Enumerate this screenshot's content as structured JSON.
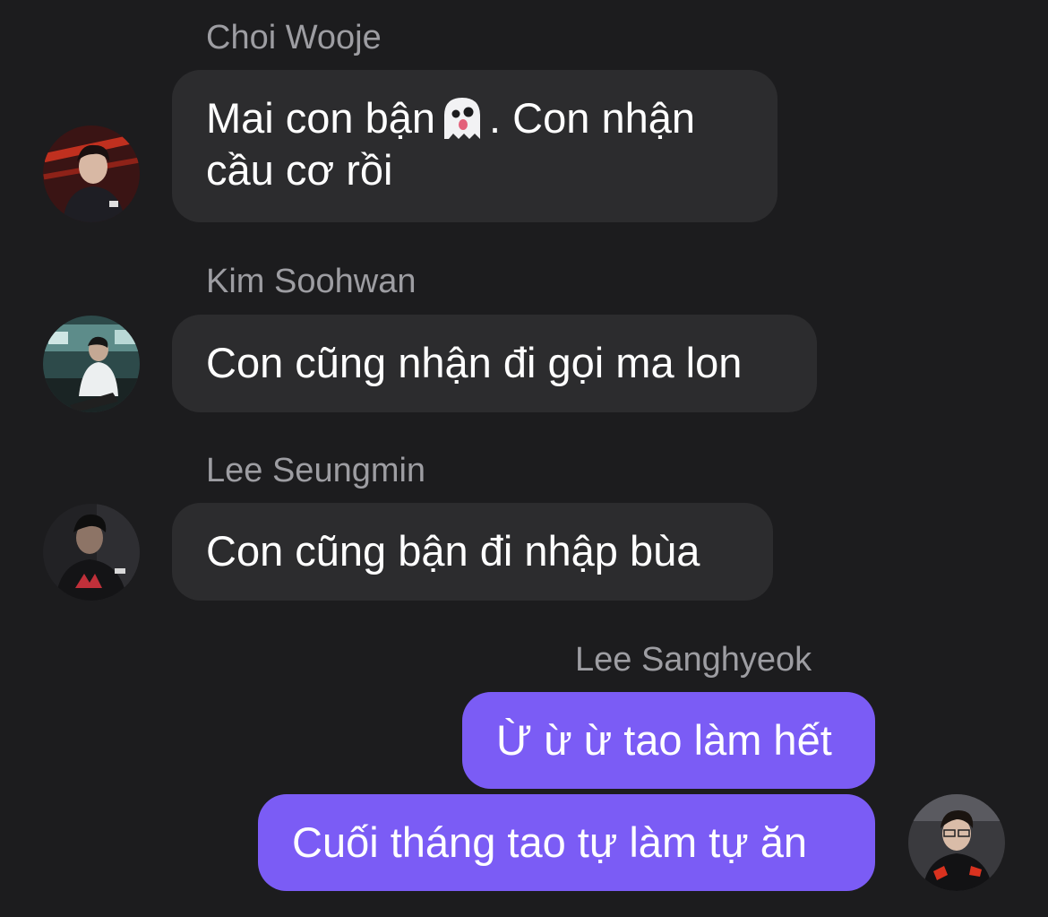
{
  "conversation": {
    "messages": [
      {
        "sender": "Choi Wooje",
        "direction": "incoming",
        "avatar": "profile-photo",
        "lines": [
          "Mai con bận",
          ". Con nhận",
          "cầu cơ rồi"
        ],
        "inline_emoji": "ghost-emoji"
      },
      {
        "sender": "Kim Soohwan",
        "direction": "incoming",
        "avatar": "profile-photo",
        "text": "Con cũng nhận đi gọi ma lon"
      },
      {
        "sender": "Lee Seungmin",
        "direction": "incoming",
        "avatar": "profile-photo",
        "text": "Con cũng bận đi nhập bùa"
      },
      {
        "sender": "Lee Sanghyeok",
        "direction": "outgoing",
        "avatar": "profile-photo",
        "bubbles": [
          "Ừ ừ ừ tao làm hết",
          "Cuối tháng tao tự làm tự ăn"
        ]
      }
    ]
  },
  "colors": {
    "background": "#1c1c1e",
    "incoming_bubble": "#2c2c2e",
    "outgoing_bubble": "#7b5cf5",
    "sender_name": "#9d9da2",
    "text": "#ffffff"
  }
}
